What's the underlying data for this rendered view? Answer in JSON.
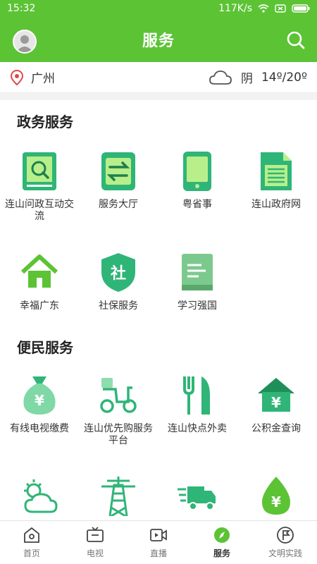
{
  "status": {
    "time": "15:32",
    "speed": "117K/s"
  },
  "header": {
    "title": "服务"
  },
  "location": {
    "city": "广州",
    "weather": "阴",
    "temp": "14º/20º"
  },
  "sections": [
    {
      "title": "政务服务",
      "items": [
        {
          "label": "连山问政互动交流",
          "icon": "search-document-icon"
        },
        {
          "label": "服务大厅",
          "icon": "exchange-icon"
        },
        {
          "label": "粤省事",
          "icon": "tablet-icon"
        },
        {
          "label": "连山政府网",
          "icon": "document-icon"
        },
        {
          "label": "幸福广东",
          "icon": "home-icon"
        },
        {
          "label": "社保服务",
          "icon": "shield-icon"
        },
        {
          "label": "学习强国",
          "icon": "book-icon"
        }
      ]
    },
    {
      "title": "便民服务",
      "items": [
        {
          "label": "有线电视缴费",
          "icon": "money-bag-icon"
        },
        {
          "label": "连山优先购服务平台",
          "icon": "scooter-icon"
        },
        {
          "label": "连山快点外卖",
          "icon": "fork-knife-icon"
        },
        {
          "label": "公积金查询",
          "icon": "house-yuan-icon"
        },
        {
          "label": "",
          "icon": "weather-icon"
        },
        {
          "label": "",
          "icon": "power-tower-icon"
        },
        {
          "label": "",
          "icon": "truck-icon"
        },
        {
          "label": "",
          "icon": "leaf-yuan-icon"
        }
      ]
    }
  ],
  "tabs": [
    {
      "label": "首页",
      "icon": "home-tab-icon"
    },
    {
      "label": "电视",
      "icon": "tv-icon"
    },
    {
      "label": "直播",
      "icon": "video-icon"
    },
    {
      "label": "服务",
      "icon": "compass-icon",
      "active": true
    },
    {
      "label": "文明实践",
      "icon": "flag-icon"
    }
  ],
  "colors": {
    "brand": "#5cc335",
    "icon_teal": "#2fb577"
  }
}
